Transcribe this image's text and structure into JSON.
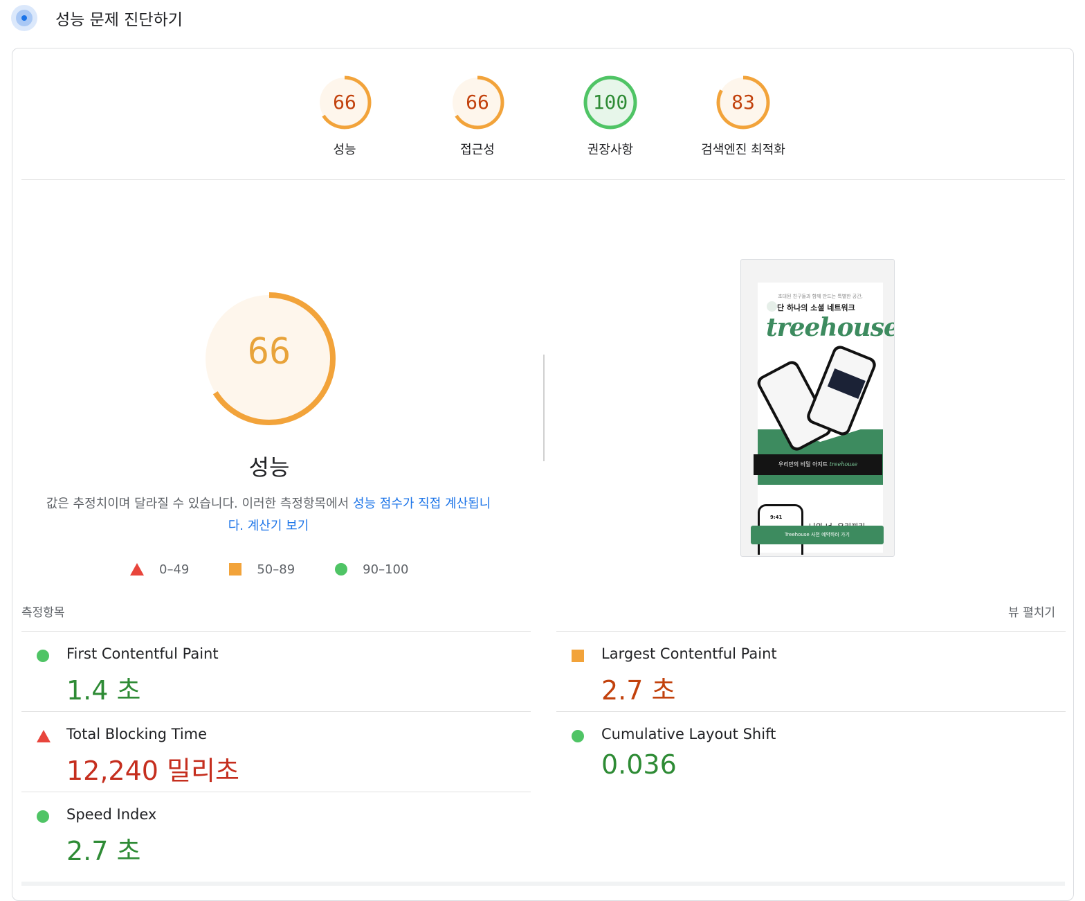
{
  "header": {
    "title": "성능 문제 진단하기"
  },
  "category_gauges": [
    {
      "score": "66",
      "label": "성능",
      "fraction": 0.66,
      "status": "average"
    },
    {
      "score": "66",
      "label": "접근성",
      "fraction": 0.66,
      "status": "average"
    },
    {
      "score": "100",
      "label": "권장사항",
      "fraction": 1.0,
      "status": "good"
    },
    {
      "score": "83",
      "label": "검색엔진 최적화",
      "fraction": 0.83,
      "status": "average"
    }
  ],
  "performance": {
    "score": "66",
    "score_fraction": 0.66,
    "title": "성능",
    "description_text": "값은 추정치이며 달라질 수 있습니다. 이러한 측정항목에서 ",
    "description_link": "성능 점수가 직접 계산됩니다.",
    "calculator_link": "계산기 보기"
  },
  "legend": [
    {
      "shape": "triangle",
      "range": "0–49"
    },
    {
      "shape": "square",
      "range": "50–89"
    },
    {
      "shape": "circle",
      "range": "90–100"
    }
  ],
  "screenshot": {
    "tagline": "초대된 친구들과 함께 만드는 특별한 공간,",
    "headline": "단 하나의 소셜 네트워크",
    "logo": "treehouse",
    "banner": "우리만의 비밀 아지트",
    "banner_logo": "treehouse",
    "time": "9:41",
    "line": "나와 너, 우리끼리",
    "cta": "Treehouse 사전 예약하러 가기"
  },
  "metrics_section": {
    "label": "측정항목",
    "expand_label": "뷰 펼치기"
  },
  "metrics": [
    {
      "title": "First Contentful Paint",
      "value": "1.4 초",
      "status": "good"
    },
    {
      "title": "Largest Contentful Paint",
      "value": "2.7 초",
      "status": "average"
    },
    {
      "title": "Total Blocking Time",
      "value": "12,240 밀리초",
      "status": "bad"
    },
    {
      "title": "Cumulative Layout Shift",
      "value": "0.036",
      "status": "good"
    },
    {
      "title": "Speed Index",
      "value": "2.7 초",
      "status": "good"
    }
  ],
  "colors": {
    "average": "#f2a33a",
    "average_text": "#c2410c",
    "average_bg": "#fef6ec",
    "good": "#4fc465",
    "good_text": "#2e8b35",
    "good_bg": "#e7f6ea",
    "bad": "#e8453c"
  }
}
